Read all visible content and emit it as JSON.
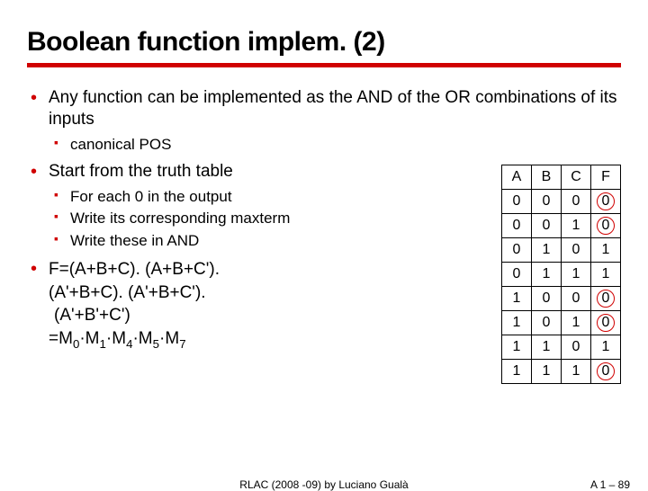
{
  "title": "Boolean function implem. (2)",
  "bullets": {
    "b1": "Any function can be implemented as the AND of the OR combinations of its inputs",
    "b1s1": "canonical POS",
    "b2": "Start from the truth table",
    "b2s1": "For each 0 in the output",
    "b2s2": "Write its corresponding maxterm",
    "b2s3": "Write these in AND"
  },
  "formula": {
    "intro": "F=(A+B+C). (A+B+C').",
    "line2": "(A'+B+C). (A'+B+C').",
    "line3": "(A'+B'+C')",
    "m_prefix": "=M",
    "sep": "·M",
    "idx": [
      "0",
      "1",
      "4",
      "5",
      "7"
    ]
  },
  "table": {
    "headers": [
      "A",
      "B",
      "C",
      "F"
    ],
    "rows": [
      {
        "a": "0",
        "b": "0",
        "c": "0",
        "f": "0",
        "circ": true
      },
      {
        "a": "0",
        "b": "0",
        "c": "1",
        "f": "0",
        "circ": true
      },
      {
        "a": "0",
        "b": "1",
        "c": "0",
        "f": "1",
        "circ": false
      },
      {
        "a": "0",
        "b": "1",
        "c": "1",
        "f": "1",
        "circ": false
      },
      {
        "a": "1",
        "b": "0",
        "c": "0",
        "f": "0",
        "circ": true
      },
      {
        "a": "1",
        "b": "0",
        "c": "1",
        "f": "0",
        "circ": true
      },
      {
        "a": "1",
        "b": "1",
        "c": "0",
        "f": "1",
        "circ": false
      },
      {
        "a": "1",
        "b": "1",
        "c": "1",
        "f": "0",
        "circ": true
      }
    ]
  },
  "footer": {
    "center": "RLAC (2008 -09) by Luciano Gualà",
    "right_prefix": "A 1 – ",
    "pageno": "89"
  },
  "chart_data": {
    "type": "table",
    "title": "Truth table for F with circled zero outputs (maxterms)",
    "columns": [
      "A",
      "B",
      "C",
      "F"
    ],
    "rows": [
      [
        0,
        0,
        0,
        0
      ],
      [
        0,
        0,
        1,
        0
      ],
      [
        0,
        1,
        0,
        1
      ],
      [
        0,
        1,
        1,
        1
      ],
      [
        1,
        0,
        0,
        0
      ],
      [
        1,
        0,
        1,
        0
      ],
      [
        1,
        1,
        0,
        1
      ],
      [
        1,
        1,
        1,
        0
      ]
    ],
    "circled_F_rows": [
      0,
      1,
      4,
      5,
      7
    ]
  }
}
